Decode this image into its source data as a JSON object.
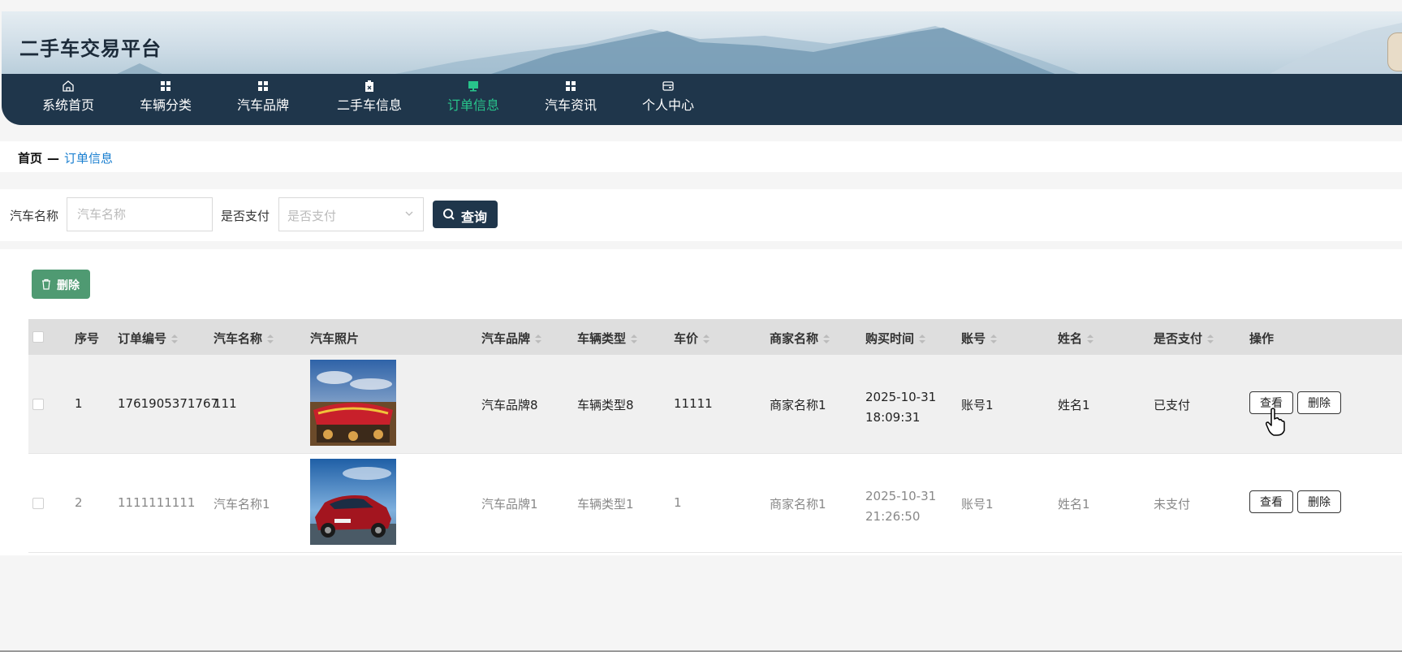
{
  "header": {
    "title": "二手车交易平台"
  },
  "nav": {
    "items": [
      {
        "label": "系统首页",
        "icon": "home-icon"
      },
      {
        "label": "车辆分类",
        "icon": "grid-icon"
      },
      {
        "label": "汽车品牌",
        "icon": "grid-icon"
      },
      {
        "label": "二手车信息",
        "icon": "clipboard-icon"
      },
      {
        "label": "订单信息",
        "icon": "monitor-icon",
        "active": true
      },
      {
        "label": "汽车资讯",
        "icon": "grid-icon"
      },
      {
        "label": "个人中心",
        "icon": "wallet-icon"
      }
    ],
    "active_color": "#28c48b"
  },
  "breadcrumb": {
    "home": "首页",
    "separator": "—",
    "current": "订单信息"
  },
  "search": {
    "car_name_label": "汽车名称",
    "car_name_placeholder": "汽车名称",
    "paid_label": "是否支付",
    "paid_placeholder": "是否支付",
    "query_button": "查询"
  },
  "toolbar": {
    "delete_button": "删除"
  },
  "table": {
    "columns": [
      "序号",
      "订单编号",
      "汽车名称",
      "汽车照片",
      "汽车品牌",
      "车辆类型",
      "车价",
      "商家名称",
      "购买时间",
      "账号",
      "姓名",
      "是否支付",
      "操作"
    ],
    "rows": [
      {
        "index": "1",
        "order_no": "1761905371767",
        "car_name": "111",
        "photo": "red-sports-car-photo",
        "brand": "汽车品牌8",
        "type": "车辆类型8",
        "price": "11111",
        "merchant": "商家名称1",
        "time": "2025-10-31 18:09:31",
        "account": "账号1",
        "name": "姓名1",
        "paid": "已支付",
        "view": "查看",
        "delete": "删除"
      },
      {
        "index": "2",
        "order_no": "1111111111",
        "car_name": "汽车名称1",
        "photo": "red-bmw-coupe-photo",
        "brand": "汽车品牌1",
        "type": "车辆类型1",
        "price": "1",
        "merchant": "商家名称1",
        "time": "2025-10-31 21:26:50",
        "account": "账号1",
        "name": "姓名1",
        "paid": "未支付",
        "view": "查看",
        "delete": "删除"
      }
    ]
  },
  "colors": {
    "nav_bg": "#1f364b",
    "delete_green": "#4f9a72",
    "link_blue": "#1a7fd0"
  }
}
